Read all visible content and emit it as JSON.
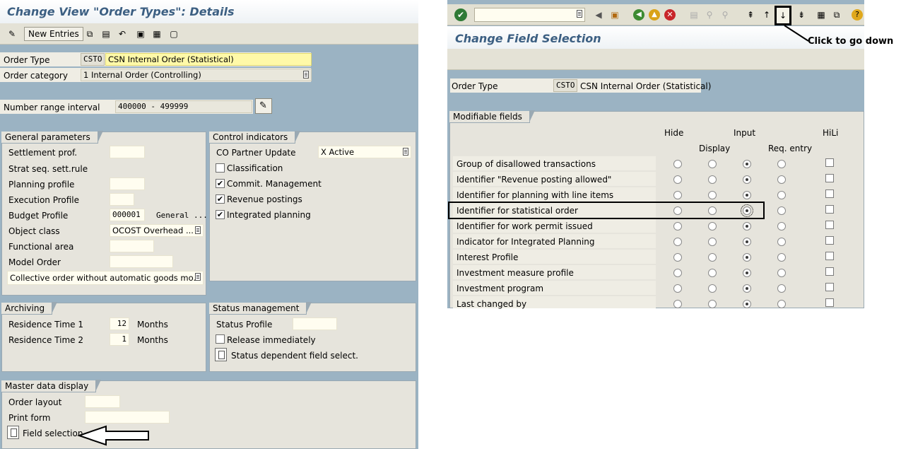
{
  "left": {
    "title": "Change View \"Order Types\": Details",
    "toolbar": {
      "new_entries": "New Entries"
    },
    "order_type": {
      "label": "Order Type",
      "code": "CSTO",
      "value": "CSN Internal Order (Statistical)"
    },
    "order_category": {
      "label": "Order category",
      "value": "1 Internal Order (Controlling)"
    },
    "number_range": {
      "label": "Number range interval",
      "value": "400000 - 499999"
    },
    "general": {
      "title": "General parameters",
      "settlement_prof": "Settlement prof.",
      "strat_seq": "Strat seq. sett.rule",
      "planning_profile": "Planning profile",
      "execution_profile": "Execution Profile",
      "budget_profile": "Budget Profile",
      "budget_value": "000001",
      "budget_text": "General ...",
      "object_class": "Object class",
      "object_class_value": "OCOST Overhead ...",
      "functional_area": "Functional area",
      "model_order": "Model Order",
      "collective": "Collective order without automatic goods mo..."
    },
    "control": {
      "title": "Control indicators",
      "co_partner": "CO Partner Update",
      "co_partner_value": "X Active",
      "classification": "Classification",
      "commit_mgmt": "Commit. Management",
      "revenue": "Revenue postings",
      "integrated": "Integrated planning"
    },
    "archiving": {
      "title": "Archiving",
      "res1": "Residence Time 1",
      "res1_value": "12",
      "res2": "Residence Time 2",
      "res2_value": "1",
      "months": "Months"
    },
    "status": {
      "title": "Status management",
      "profile": "Status Profile",
      "release": "Release immediately",
      "dependent": "Status dependent field select."
    },
    "master": {
      "title": "Master data display",
      "order_layout": "Order layout",
      "print_form": "Print form",
      "field_selection": "Field selection"
    }
  },
  "right": {
    "title": "Change Field Selection",
    "order_type_label": "Order Type",
    "order_type_code": "CSTO",
    "order_type_value": "CSN Internal Order (Statistical)",
    "section_title": "Modifiable fields",
    "headers": {
      "hide": "Hide",
      "display": "Display",
      "input": "Input",
      "req_entry": "Req. entry",
      "hili": "HiLi"
    },
    "rows": [
      "Group of disallowed transactions",
      "Identifier \"Revenue posting allowed\"",
      "Identifier for planning with line items",
      "Identifier for statistical order",
      "Identifier for work permit issued",
      "Indicator for Integrated Planning",
      "Interest Profile",
      "Investment measure profile",
      "Investment program",
      "Last changed by"
    ],
    "annotation": "Click to go down"
  }
}
